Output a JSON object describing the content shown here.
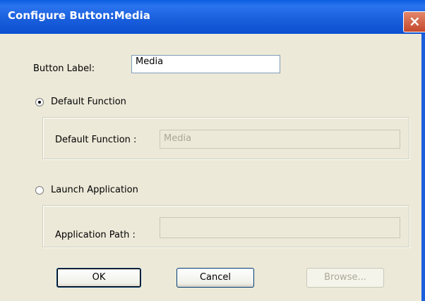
{
  "window": {
    "title": "Configure Button:Media",
    "close_glyph": "×"
  },
  "button_label": {
    "label": "Button Label:",
    "value": "Media"
  },
  "default_function": {
    "radio_label": "Default Function",
    "selected": true,
    "field_label": "Default Function :",
    "field_value": "Media"
  },
  "launch_application": {
    "radio_label": "Launch Application",
    "selected": false,
    "field_label": "Application Path :",
    "field_value": ""
  },
  "buttons": {
    "ok": "OK",
    "cancel": "Cancel",
    "browse": "Browse..."
  }
}
